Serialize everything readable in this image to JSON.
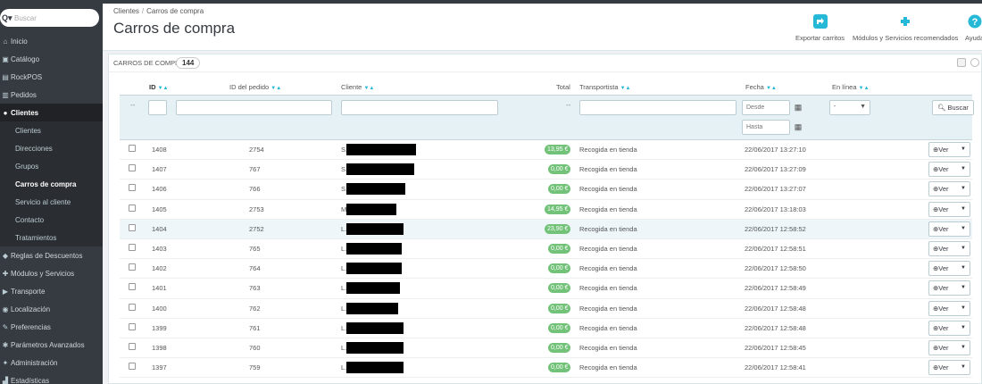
{
  "sidebar": {
    "search_placeholder": "Buscar",
    "items": [
      {
        "label": "Inicio",
        "icon": "home-icon",
        "glyph": "⌂"
      },
      {
        "label": "Catálogo",
        "icon": "book-icon",
        "glyph": "▣"
      },
      {
        "label": "RockPOS",
        "icon": "pos-icon",
        "glyph": "▤"
      },
      {
        "label": "Pedidos",
        "icon": "cart-icon",
        "glyph": "▥"
      },
      {
        "label": "Clientes",
        "icon": "user-icon",
        "glyph": "●"
      },
      {
        "label": "Reglas de Descuentos",
        "icon": "tag-icon",
        "glyph": "◆"
      },
      {
        "label": "Módulos y Servicios",
        "icon": "puzzle-icon",
        "glyph": "✚"
      },
      {
        "label": "Transporte",
        "icon": "truck-icon",
        "glyph": "▶"
      },
      {
        "label": "Localización",
        "icon": "globe-icon",
        "glyph": "◉"
      },
      {
        "label": "Preferencias",
        "icon": "wrench-icon",
        "glyph": "✎"
      },
      {
        "label": "Parámetros Avanzados",
        "icon": "cogs-icon",
        "glyph": "✱"
      },
      {
        "label": "Administración",
        "icon": "gear-icon",
        "glyph": "✦"
      },
      {
        "label": "Estadísticas",
        "icon": "chart-icon",
        "glyph": "▟"
      }
    ],
    "sub_items": [
      "Clientes",
      "Direcciones",
      "Grupos",
      "Carros de compra",
      "Servicio al cliente",
      "Contacto",
      "Tratamientos"
    ]
  },
  "header": {
    "breadcrumb_1": "Clientes",
    "breadcrumb_sep": "/",
    "breadcrumb_2": "Carros de compra",
    "title": "Carros de compra",
    "export_label": "Exportar carritos",
    "modules_label": "Módulos y Servicios recomendados",
    "help_label": "Ayuda"
  },
  "panel": {
    "title": "CARROS DE COMPRA",
    "count": "144"
  },
  "columns": {
    "id": "ID",
    "order_id": "ID del pedido",
    "customer": "Cliente",
    "total": "Total",
    "carrier": "Transportista",
    "date": "Fecha",
    "online": "En línea"
  },
  "filters": {
    "dash": "--",
    "date_from": "Desde",
    "date_to": "Hasta",
    "online_value": "-",
    "search_button": "Buscar"
  },
  "rows": [
    {
      "id": "1408",
      "order": "2754",
      "customer": "S.",
      "total": "13,95 €",
      "carrier": "Recogida en tienda",
      "date": "22/06/2017 13:27:10",
      "action": "Ver"
    },
    {
      "id": "1407",
      "order": "767",
      "customer": "S.",
      "total": "0,00 €",
      "carrier": "Recogida en tienda",
      "date": "22/06/2017 13:27:09",
      "action": "Ver"
    },
    {
      "id": "1406",
      "order": "766",
      "customer": "S.",
      "total": "0,00 €",
      "carrier": "Recogida en tienda",
      "date": "22/06/2017 13:27:07",
      "action": "Ver"
    },
    {
      "id": "1405",
      "order": "2753",
      "customer": "M.",
      "total": "14,95 €",
      "carrier": "Recogida en tienda",
      "date": "22/06/2017 13:18:03",
      "action": "Ver"
    },
    {
      "id": "1404",
      "order": "2752",
      "customer": "L.",
      "total": "23,90 €",
      "carrier": "Recogida en tienda",
      "date": "22/06/2017 12:58:52",
      "action": "Ver"
    },
    {
      "id": "1403",
      "order": "765",
      "customer": "L.",
      "total": "0,00 €",
      "carrier": "Recogida en tienda",
      "date": "22/06/2017 12:58:51",
      "action": "Ver"
    },
    {
      "id": "1402",
      "order": "764",
      "customer": "L.",
      "total": "0,00 €",
      "carrier": "Recogida en tienda",
      "date": "22/06/2017 12:58:50",
      "action": "Ver"
    },
    {
      "id": "1401",
      "order": "763",
      "customer": "L.",
      "total": "0,00 €",
      "carrier": "Recogida en tienda",
      "date": "22/06/2017 12:58:49",
      "action": "Ver"
    },
    {
      "id": "1400",
      "order": "762",
      "customer": "L.",
      "total": "0,00 €",
      "carrier": "Recogida en tienda",
      "date": "22/06/2017 12:58:48",
      "action": "Ver"
    },
    {
      "id": "1399",
      "order": "761",
      "customer": "L.",
      "total": "0,00 €",
      "carrier": "Recogida en tienda",
      "date": "22/06/2017 12:58:48",
      "action": "Ver"
    },
    {
      "id": "1398",
      "order": "760",
      "customer": "L.",
      "total": "0,00 €",
      "carrier": "Recogida en tienda",
      "date": "22/06/2017 12:58:45",
      "action": "Ver"
    },
    {
      "id": "1397",
      "order": "759",
      "customer": "L.",
      "total": "0,00 €",
      "carrier": "Recogida en tienda",
      "date": "22/06/2017 12:58:41",
      "action": "Ver"
    }
  ],
  "colors": {
    "sidebar_bg": "#363a41",
    "accent": "#25b9d7",
    "total_pill": "#72c279"
  }
}
